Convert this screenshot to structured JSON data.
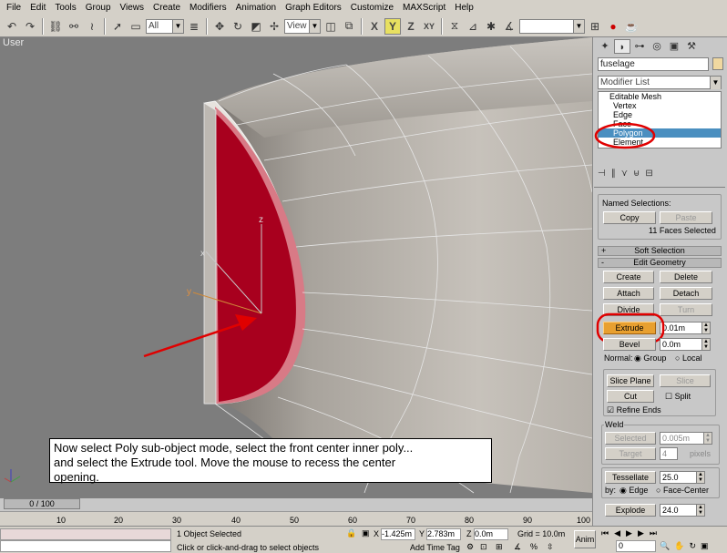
{
  "menu": [
    "File",
    "Edit",
    "Tools",
    "Group",
    "Views",
    "Create",
    "Modifiers",
    "Animation",
    "Graph Editors",
    "Customize",
    "MAXScript",
    "Help"
  ],
  "toolbar": {
    "selection_filter": "All",
    "coord_system": "View",
    "named_set": ""
  },
  "viewport": {
    "label": "User",
    "gizmo_labels": {
      "z": "z",
      "x": "x",
      "y": "y"
    },
    "instruction_line1": "Now select Poly sub-object mode, select the front center inner poly...",
    "instruction_line2": "and select the Extrude tool.  Move the mouse to recess the center",
    "instruction_line3": "opening.",
    "colors": {
      "selected_poly": "#a8001e",
      "mesh_grey": "#b3ada6",
      "wire": "#e6e6e6",
      "annotation": "#e00000"
    }
  },
  "panel": {
    "object_name": "fuselage",
    "modifier_list": "Modifier List",
    "stack": [
      "Editable Mesh",
      "Vertex",
      "Edge",
      "Face",
      "Polygon",
      "Element"
    ],
    "stack_selected": "Polygon",
    "named_selections": "Named Selections:",
    "copy": "Copy",
    "paste": "Paste",
    "faces_selected": "11 Faces Selected",
    "soft_selection": "Soft Selection",
    "edit_geometry": "Edit Geometry",
    "create": "Create",
    "delete": "Delete",
    "attach": "Attach",
    "detach": "Detach",
    "divide": "Divide",
    "turn": "Turn",
    "extrude": "Extrude",
    "extrude_value": "0.01m",
    "bevel": "Bevel",
    "bevel_value": "0.0m",
    "normal_label": "Normal:",
    "group": "Group",
    "local": "Local",
    "slice_plane": "Slice Plane",
    "slice": "Slice",
    "cut": "Cut",
    "split": "Split",
    "refine_ends": "Refine Ends",
    "weld": "Weld",
    "selected": "Selected",
    "selected_value": "0.005m",
    "target": "Target",
    "target_value": "4",
    "pixels": "pixels",
    "tessellate": "Tessellate",
    "tessellate_value": "25.0",
    "by": "by:",
    "edge": "Edge",
    "face_center": "Face-Center",
    "explode": "Explode",
    "explode_value": "24.0",
    "plus": "+",
    "minus": "-"
  },
  "timeline": {
    "slider": "0 / 100",
    "ticks": [
      "10",
      "20",
      "30",
      "40",
      "50",
      "60",
      "70",
      "80",
      "90",
      "100"
    ]
  },
  "status": {
    "objects_selected": "1 Object Selected",
    "prompt": "Click or click-and-drag to select objects",
    "x_label": "X",
    "x_value": "-1.425m",
    "y_label": "Y",
    "y_value": "2.783m",
    "z_label": "Z",
    "z_value": "0.0m",
    "grid": "Grid = 10.0m",
    "add_time_tag": "Add Time Tag",
    "anim": "Anim",
    "frame": "0"
  }
}
